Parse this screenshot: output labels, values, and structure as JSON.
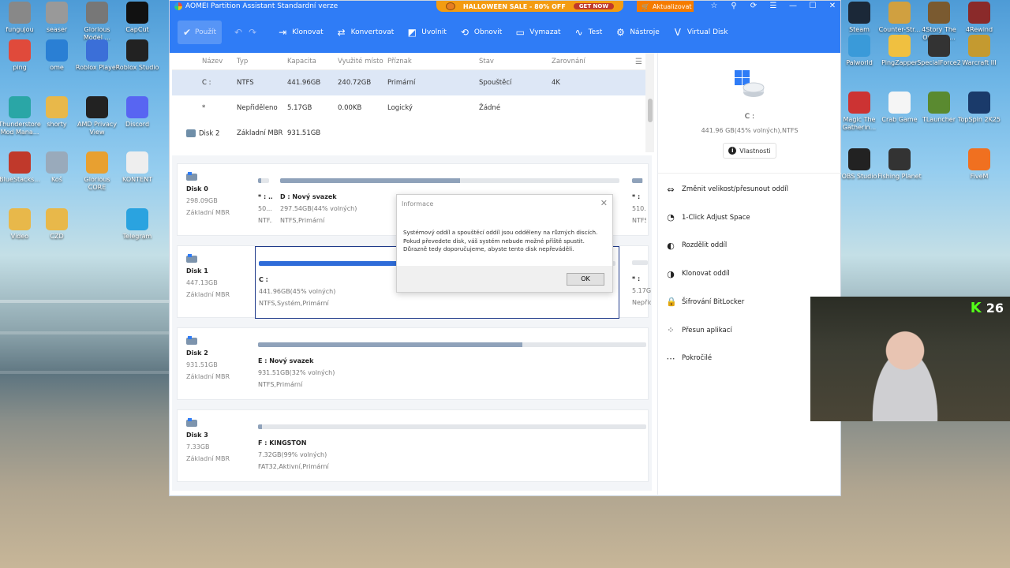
{
  "desktop": {
    "left_icons": [
      {
        "label": "fungujou",
        "color": "#888888"
      },
      {
        "label": "seaser",
        "color": "#999999"
      },
      {
        "label": "Glorious Model ...",
        "color": "#777777"
      },
      {
        "label": "CapCut",
        "color": "#111111"
      },
      {
        "label": "ping",
        "color": "#e04a3b"
      },
      {
        "label": "ome",
        "color": "#2a7fd4"
      },
      {
        "label": "Roblox Player",
        "color": "#3b6fd8"
      },
      {
        "label": "Roblox Studio",
        "color": "#222222"
      },
      {
        "label": "Thunderstore Mod Mana...",
        "color": "#2aa6a6"
      },
      {
        "label": "shorty",
        "color": "#e8b84a"
      },
      {
        "label": "AMD Privacy View",
        "color": "#222222"
      },
      {
        "label": "Discord",
        "color": "#5865f2"
      },
      {
        "label": "BlueStacks...",
        "color": "#c0392b"
      },
      {
        "label": "Koš",
        "color": "#9ab"
      },
      {
        "label": "Glorious CORE",
        "color": "#e8a030"
      },
      {
        "label": "KONTENT",
        "color": "#eeeeee"
      },
      {
        "label": "Video",
        "color": "#e8b84a"
      },
      {
        "label": "CZD",
        "color": "#e8b84a"
      },
      {
        "label": "Telegram",
        "color": "#2aa3e0"
      }
    ],
    "right_icons": [
      {
        "label": "Steam",
        "color": "#1b2838"
      },
      {
        "label": "Counter-Str... 2",
        "color": "#d0a040"
      },
      {
        "label": "4Story The Original ...",
        "color": "#7a5a30"
      },
      {
        "label": "4Rewind",
        "color": "#8a2a2a"
      },
      {
        "label": "Palworld",
        "color": "#3a9ad9"
      },
      {
        "label": "PingZapper",
        "color": "#f0c040"
      },
      {
        "label": "SpecialForce2",
        "color": "#333333"
      },
      {
        "label": "Warcraft III",
        "color": "#c49a30"
      },
      {
        "label": "Magic The Gatherin...",
        "color": "#cc3333"
      },
      {
        "label": "Crab Game",
        "color": "#f5f5f5"
      },
      {
        "label": "TLauncher",
        "color": "#5a8a30"
      },
      {
        "label": "TopSpin 2K25",
        "color": "#1a3a6a"
      },
      {
        "label": "OBS Studio",
        "color": "#222222"
      },
      {
        "label": "Fishing Planet",
        "color": "#333333"
      },
      {
        "label": "FiveM",
        "color": "#f07020"
      }
    ]
  },
  "app": {
    "title": "AOMEI Partition Assistant Standardní verze",
    "promo": {
      "text": "HALLOWEEN SALE - 80% OFF",
      "button": "GET NOW"
    },
    "upgrade_label": "Aktualizovat",
    "toolbar": {
      "apply": "Použít",
      "buttons": [
        "Klonovat",
        "Konvertovat",
        "Uvolnit",
        "Obnovit",
        "Vymazat",
        "Test",
        "Nástroje",
        "Virtual Disk"
      ]
    },
    "list": {
      "headers": [
        "Název",
        "Typ",
        "Kapacita",
        "Využité místo",
        "Příznak",
        "Stav",
        "Zarovnání"
      ],
      "rows": [
        [
          "C :",
          "NTFS",
          "441.96GB",
          "240.72GB",
          "Primární",
          "Spouštěcí",
          "4K"
        ],
        [
          "*",
          "Nepřiděleno",
          "5.17GB",
          "0.00KB",
          "Logický",
          "Žádné",
          ""
        ],
        [
          "Disk 2",
          "Základní MBR",
          "931.51GB",
          "",
          "",
          "",
          ""
        ]
      ]
    },
    "disks": [
      {
        "name": "Disk 0",
        "size": "298.09GB",
        "type": "Základní MBR",
        "parts": [
          {
            "label": "* : ...",
            "size": "50...",
            "fs": "NTF...",
            "used": 0.3
          },
          {
            "label": "D : Nový svazek",
            "size": "297.54GB(44% volných)",
            "fs": "NTFS,Primární",
            "used": 0.53
          },
          {
            "label": "* :",
            "size": "510.00...",
            "fs": "NTFS...",
            "used": 0.9
          }
        ]
      },
      {
        "name": "Disk 1",
        "size": "447.13GB",
        "type": "Základní MBR",
        "parts": [
          {
            "label": "C :",
            "size": "441.96GB(45% volných)",
            "fs": "NTFS,Systém,Primární",
            "used": 0.55
          },
          {
            "label": "* :",
            "size": "5.17GB",
            "fs": "Nepřidě...",
            "used": 0.0
          }
        ]
      },
      {
        "name": "Disk 2",
        "size": "931.51GB",
        "type": "Základní MBR",
        "parts": [
          {
            "label": "E : Nový svazek",
            "size": "931.51GB(32% volných)",
            "fs": "NTFS,Primární",
            "used": 0.68
          }
        ]
      },
      {
        "name": "Disk 3",
        "size": "7.33GB",
        "type": "Základní MBR",
        "parts": [
          {
            "label": "F : KINGSTON",
            "size": "7.32GB(99% volných)",
            "fs": "FAT32,Aktivní,Primární",
            "used": 0.01
          }
        ]
      }
    ],
    "panel": {
      "name": "C :",
      "sub": "441.96 GB(45% volných),NTFS",
      "properties": "Vlastnosti",
      "actions": [
        {
          "label": "Změnit velikost/přesunout oddíl",
          "icon": "resize-icon"
        },
        {
          "label": "1-Click Adjust Space",
          "icon": "adjust-icon"
        },
        {
          "label": "Rozdělit oddíl",
          "icon": "split-icon"
        },
        {
          "label": "Klonovat oddíl",
          "icon": "clone-icon"
        },
        {
          "label": "Šifrování BitLocker",
          "icon": "lock-icon"
        },
        {
          "label": "Přesun aplikací",
          "icon": "apps-icon"
        },
        {
          "label": "Pokročilé",
          "icon": "more-icon"
        }
      ]
    },
    "dialog": {
      "title": "Informace",
      "message": "Systémový oddíl a spouštěcí oddíl jsou odděleny na různých discích. Pokud převedete disk, váš systém nebude možné příště spustit. Důrazně tedy doporučujeme, abyste tento disk nepřeváděli.",
      "ok": "OK"
    }
  },
  "webcam": {
    "viewer_count": "26"
  },
  "colors": {
    "accent": "#2f7cf6",
    "promo": "#f39c12",
    "upgrade": "#f57c00"
  }
}
